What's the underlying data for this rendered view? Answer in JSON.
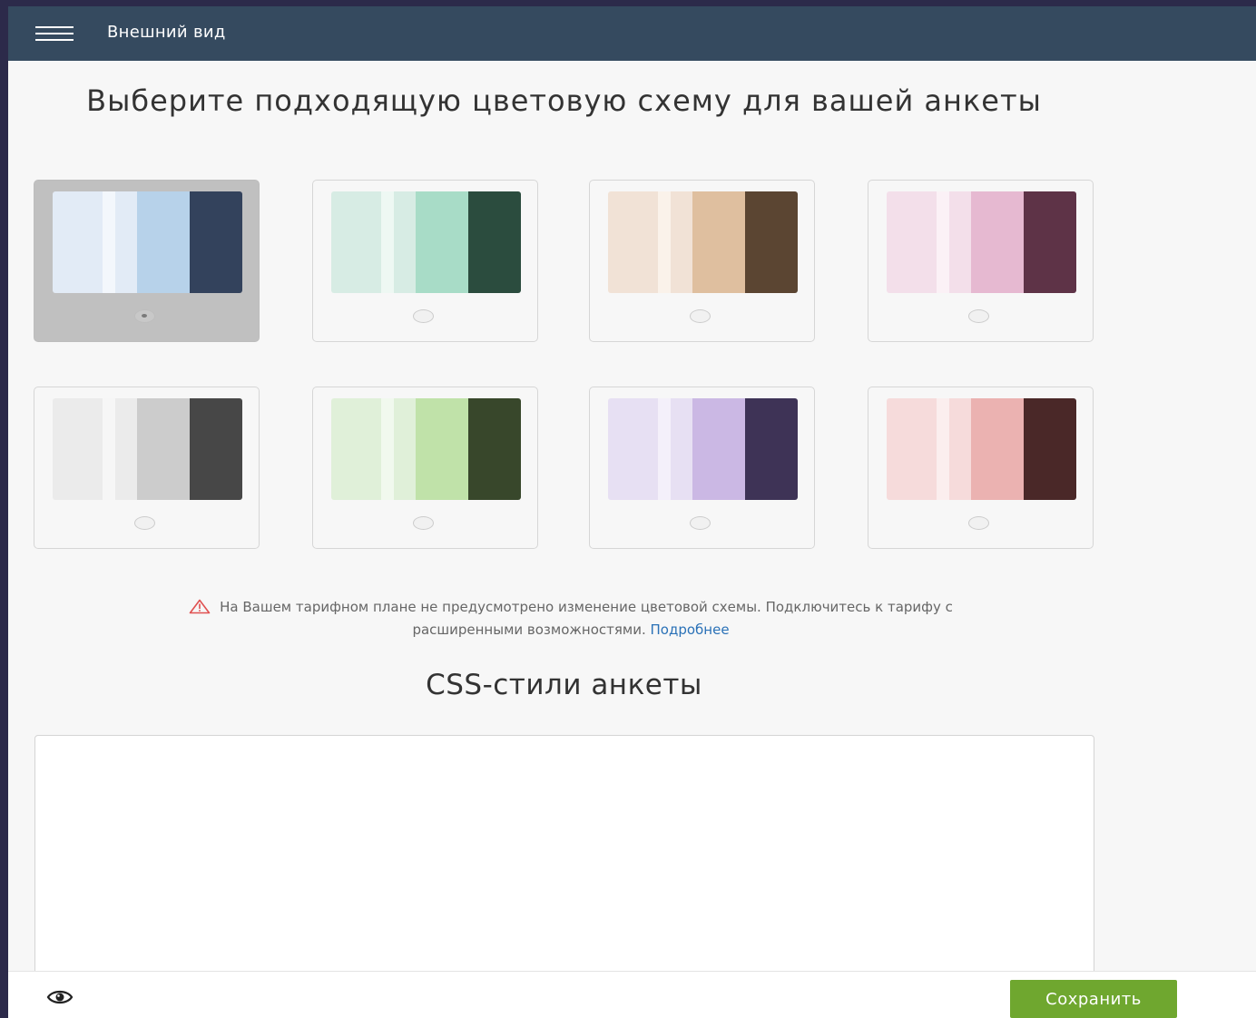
{
  "topbar": {
    "title": "Внешний вид"
  },
  "heading": "Выберите подходящую цветовую схему для вашей анкеты",
  "schemes": [
    {
      "colors": [
        "#e2ebf6",
        "#f3f7fc",
        "#e2ebf6",
        "#b7d2ea",
        "#33425c"
      ],
      "selected": true
    },
    {
      "colors": [
        "#d7ece4",
        "#eef8f3",
        "#d7ece4",
        "#a8dcc7",
        "#2b4c3e"
      ],
      "selected": false
    },
    {
      "colors": [
        "#f1e2d6",
        "#faf2ea",
        "#f1e2d6",
        "#dfbf9f",
        "#5b4532"
      ],
      "selected": false
    },
    {
      "colors": [
        "#f3dfea",
        "#fbf1f6",
        "#f3dfea",
        "#e6b9d1",
        "#5e3347"
      ],
      "selected": false
    },
    {
      "colors": [
        "#ebebeb",
        "#f6f6f6",
        "#ebebeb",
        "#cccccc",
        "#474747"
      ],
      "selected": false
    },
    {
      "colors": [
        "#e0f0d9",
        "#f1f9ee",
        "#e0f0d9",
        "#c0e2a9",
        "#38472b"
      ],
      "selected": false
    },
    {
      "colors": [
        "#e7e0f3",
        "#f4f0fa",
        "#e7e0f3",
        "#cbb8e4",
        "#3e3356"
      ],
      "selected": false
    },
    {
      "colors": [
        "#f6dbdb",
        "#fbeeee",
        "#f6dbdb",
        "#ebb2b1",
        "#4a2828"
      ],
      "selected": false
    }
  ],
  "notice": {
    "text_line1": "На Вашем тарифном плане не предусмотрено изменение цветовой схемы. Подключитесь к тарифу с",
    "text_line2": "расширенными возможностями. ",
    "link": "Подробнее"
  },
  "css_section": {
    "title": "CSS-стили анкеты",
    "value": ""
  },
  "footer": {
    "save_label": "Сохранить"
  },
  "colors": {
    "topbar": "#354a5f",
    "save_button": "#6fa72f",
    "link": "#2a71b7",
    "warning": "#e05050"
  }
}
